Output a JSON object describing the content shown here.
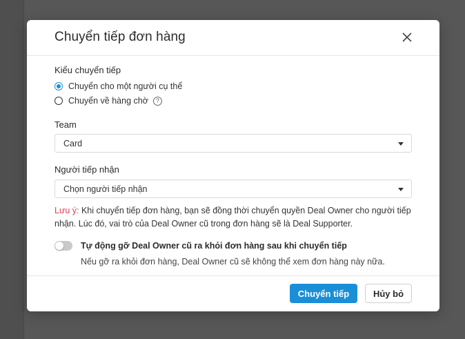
{
  "dialog": {
    "title": "Chuyển tiếp đơn hàng",
    "close_icon": "close-icon"
  },
  "transfer_type": {
    "label": "Kiểu chuyển tiếp",
    "options": [
      {
        "label": "Chuyển cho một người cụ thể",
        "selected": true
      },
      {
        "label": "Chuyển về hàng chờ",
        "selected": false,
        "help_icon": "help-circle-icon"
      }
    ]
  },
  "team": {
    "label": "Team",
    "value": "Card"
  },
  "receiver": {
    "label": "Người tiếp nhận",
    "placeholder": "Chọn người tiếp nhận"
  },
  "note": {
    "prefix": "Lưu ý:",
    "text": " Khi chuyển tiếp đơn hàng, bạn sẽ đồng thời chuyển quyền Deal Owner cho người tiếp nhận. Lúc đó, vai trò của Deal Owner cũ trong đơn hàng sẽ là Deal Supporter."
  },
  "auto_remove": {
    "enabled": false,
    "title": "Tự động gỡ Deal Owner cũ ra khỏi đơn hàng sau khi chuyển tiếp",
    "description": "Nếu gỡ ra khỏi đơn hàng, Deal Owner cũ sẽ không thể xem đơn hàng này nữa."
  },
  "footer": {
    "confirm_label": "Chuyển tiếp",
    "cancel_label": "Hủy bỏ"
  },
  "colors": {
    "primary": "#1a8fd8",
    "note_prefix": "#e0405a",
    "overlay": "#575757"
  }
}
